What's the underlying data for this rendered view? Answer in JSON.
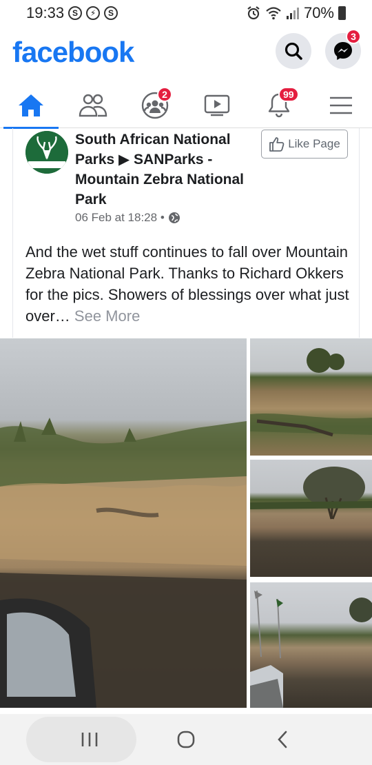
{
  "status_bar": {
    "time": "19:33",
    "left_icons": [
      "S",
      "S"
    ],
    "battery": "70%"
  },
  "header": {
    "logo": "facebook",
    "messenger_badge": "3"
  },
  "tabs": [
    {
      "name": "home",
      "badge": ""
    },
    {
      "name": "friends",
      "badge": ""
    },
    {
      "name": "groups",
      "badge": "2"
    },
    {
      "name": "watch",
      "badge": ""
    },
    {
      "name": "notifications",
      "badge": "99"
    },
    {
      "name": "menu",
      "badge": ""
    }
  ],
  "post": {
    "page_name": "South African National Parks ▶ SANParks - Mountain Zebra National Park",
    "avatar_text": "South African National Parks",
    "time": "06 Feb at 18:28 •",
    "like_button": "Like Page",
    "text": "And the wet stuff continues to fall over Mountain Zebra National Park. Thanks to Richard Okkers for the pics. Showers of blessings over what just over…",
    "see_more": "See More"
  },
  "colors": {
    "brand": "#1877f2",
    "badge": "#e41e3f"
  }
}
